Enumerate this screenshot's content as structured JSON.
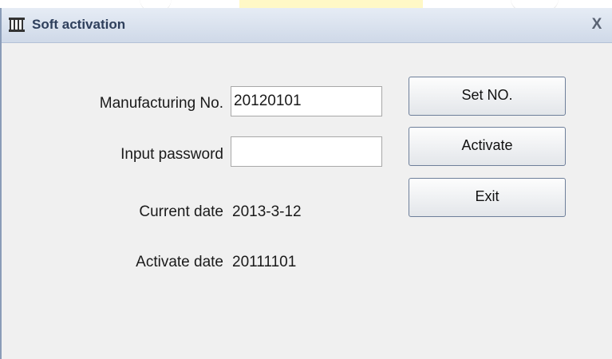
{
  "window": {
    "title": "Soft activation",
    "close_label": "X"
  },
  "form": {
    "manufacturing_label": "Manufacturing No.",
    "manufacturing_value": "20120101",
    "password_label": "Input password",
    "password_value": "",
    "current_date_label": "Current date",
    "current_date_value": "2013-3-12",
    "activate_date_label": "Activate date",
    "activate_date_value": "20111101"
  },
  "buttons": {
    "set_no": "Set NO.",
    "activate": "Activate",
    "exit": "Exit"
  },
  "icons": {
    "app": "piano-keys-icon"
  },
  "colors": {
    "titlebar": "#cfd9e8",
    "title_text": "#2e3f5c",
    "window_bg": "#f0f0f0",
    "button_border": "#6e7f9a"
  }
}
